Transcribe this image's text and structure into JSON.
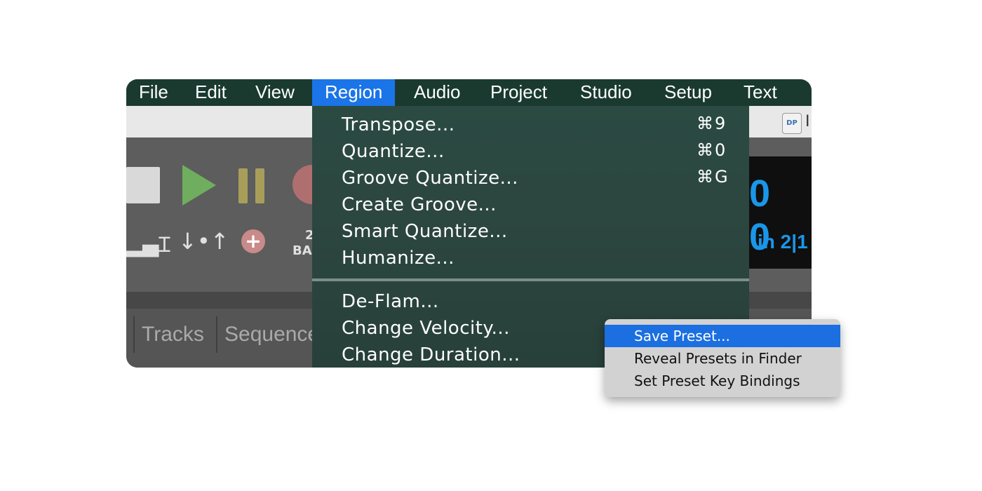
{
  "menubar": {
    "items": [
      {
        "label": "File"
      },
      {
        "label": "Edit"
      },
      {
        "label": "View"
      },
      {
        "label": "Region",
        "active": true
      },
      {
        "label": "Audio"
      },
      {
        "label": "Project"
      },
      {
        "label": "Studio"
      },
      {
        "label": "Setup"
      },
      {
        "label": "Text"
      }
    ]
  },
  "app_icon": {
    "label": "DP"
  },
  "transport": {
    "counter_big": "0 0",
    "counter_small": "in  2|1",
    "bar_label": "BA",
    "bar_number": "2"
  },
  "tabs": [
    {
      "label": "Tracks"
    },
    {
      "label": "Sequence"
    }
  ],
  "region_menu": {
    "group1": [
      {
        "label": "Transpose...",
        "shortcut": "⌘9"
      },
      {
        "label": "Quantize...",
        "shortcut": "⌘0"
      },
      {
        "label": "Groove Quantize...",
        "shortcut": "⌘G"
      },
      {
        "label": "Create Groove...",
        "shortcut": ""
      },
      {
        "label": "Smart Quantize...",
        "shortcut": ""
      },
      {
        "label": "Humanize...",
        "shortcut": ""
      }
    ],
    "group2": [
      {
        "label": "De-Flam..."
      },
      {
        "label": "Change Velocity..."
      },
      {
        "label": "Change Duration..."
      }
    ]
  },
  "preset_menu": {
    "items": [
      {
        "label": "Save Preset...",
        "highlighted": true
      },
      {
        "label": "Reveal Presets in Finder"
      },
      {
        "label": "Set Preset Key Bindings"
      }
    ]
  },
  "colors": {
    "menubar_bg": "#1a3a30",
    "menu_highlight": "#1b74e8",
    "lcd_text": "#1a96e8"
  }
}
